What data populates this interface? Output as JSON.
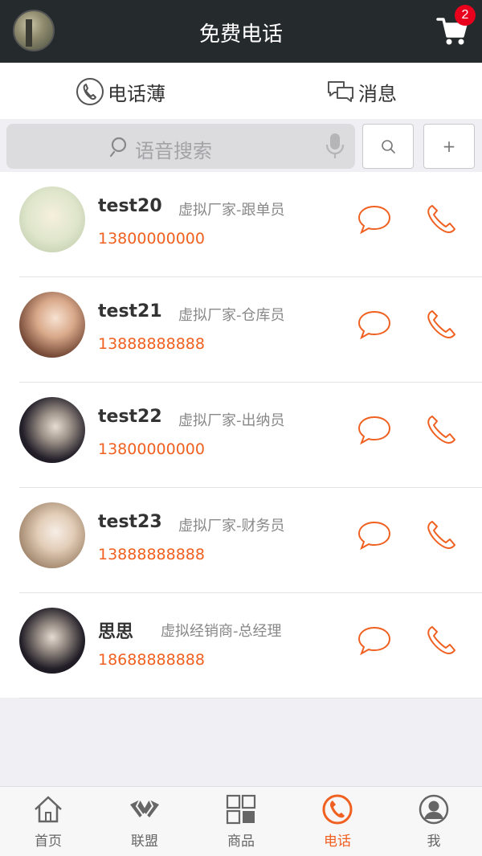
{
  "header": {
    "title": "免费电话",
    "cart_badge": "2"
  },
  "tabs": [
    {
      "label": "电话薄",
      "active": true
    },
    {
      "label": "消息",
      "active": false
    }
  ],
  "search": {
    "placeholder": "语音搜索",
    "search_button_icon": "search-icon",
    "add_button": "+"
  },
  "contacts": [
    {
      "name": "test20",
      "role": "虚拟厂家-跟单员",
      "phone": "13800000000"
    },
    {
      "name": "test21",
      "role": "虚拟厂家-仓库员",
      "phone": "13888888888"
    },
    {
      "name": "test22",
      "role": "虚拟厂家-出纳员",
      "phone": "13800000000"
    },
    {
      "name": "test23",
      "role": "虚拟厂家-财务员",
      "phone": "13888888888"
    },
    {
      "name": "思思",
      "role": "虚拟经销商-总经理",
      "phone": "18688888888"
    }
  ],
  "bottom_nav": [
    {
      "label": "首页",
      "icon": "home-icon"
    },
    {
      "label": "联盟",
      "icon": "alliance-icon"
    },
    {
      "label": "商品",
      "icon": "grid-icon"
    },
    {
      "label": "电话",
      "icon": "phone-icon",
      "active": true
    },
    {
      "label": "我",
      "icon": "user-icon"
    }
  ],
  "colors": {
    "accent": "#f06020",
    "header_bg": "#252a2d",
    "tab_indicator": "#e55e55",
    "badge": "#e8001c"
  }
}
